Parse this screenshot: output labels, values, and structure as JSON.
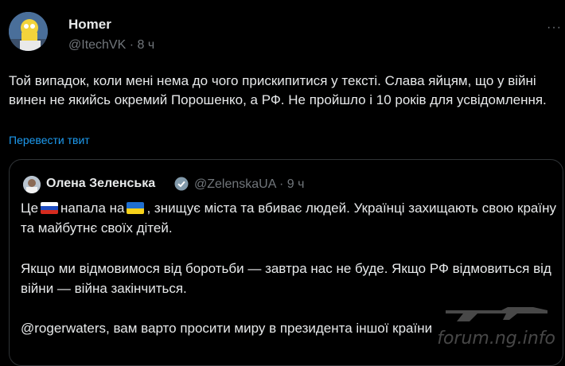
{
  "tweet": {
    "author_name": "Homer",
    "handle_time": "@ItechVK · 8 ч",
    "more_label": "···",
    "text": "Той випадок, коли мені нема до чого прискипитися у тексті. Слава яйцям, що у війні винен не якийсь окремий Порошенко, а РФ. Не пройшло і 10 років для усвідомлення.",
    "translate_label": "Перевести твит"
  },
  "quote": {
    "author_name": "Олена Зеленська",
    "handle_time": "@ZelenskaUA · 9 ч",
    "p1_a": "Це",
    "p1_b": "напала на",
    "p1_c": ", знищує міста та вбиває людей. Українці захищають свою країну та майбутнє своїх дітей.",
    "p2": "Якщо ми відмовимося від боротьби — завтра нас не буде. Якщо РФ відмовиться від війни — війна закінчиться.",
    "p3": "@rogerwaters, вам варто просити миру в президента іншої країни"
  },
  "watermark": "forum.ng.info",
  "colors": {
    "background": "#000000",
    "link": "#1d9bf0",
    "muted": "#71767b",
    "border": "#2f3336"
  }
}
